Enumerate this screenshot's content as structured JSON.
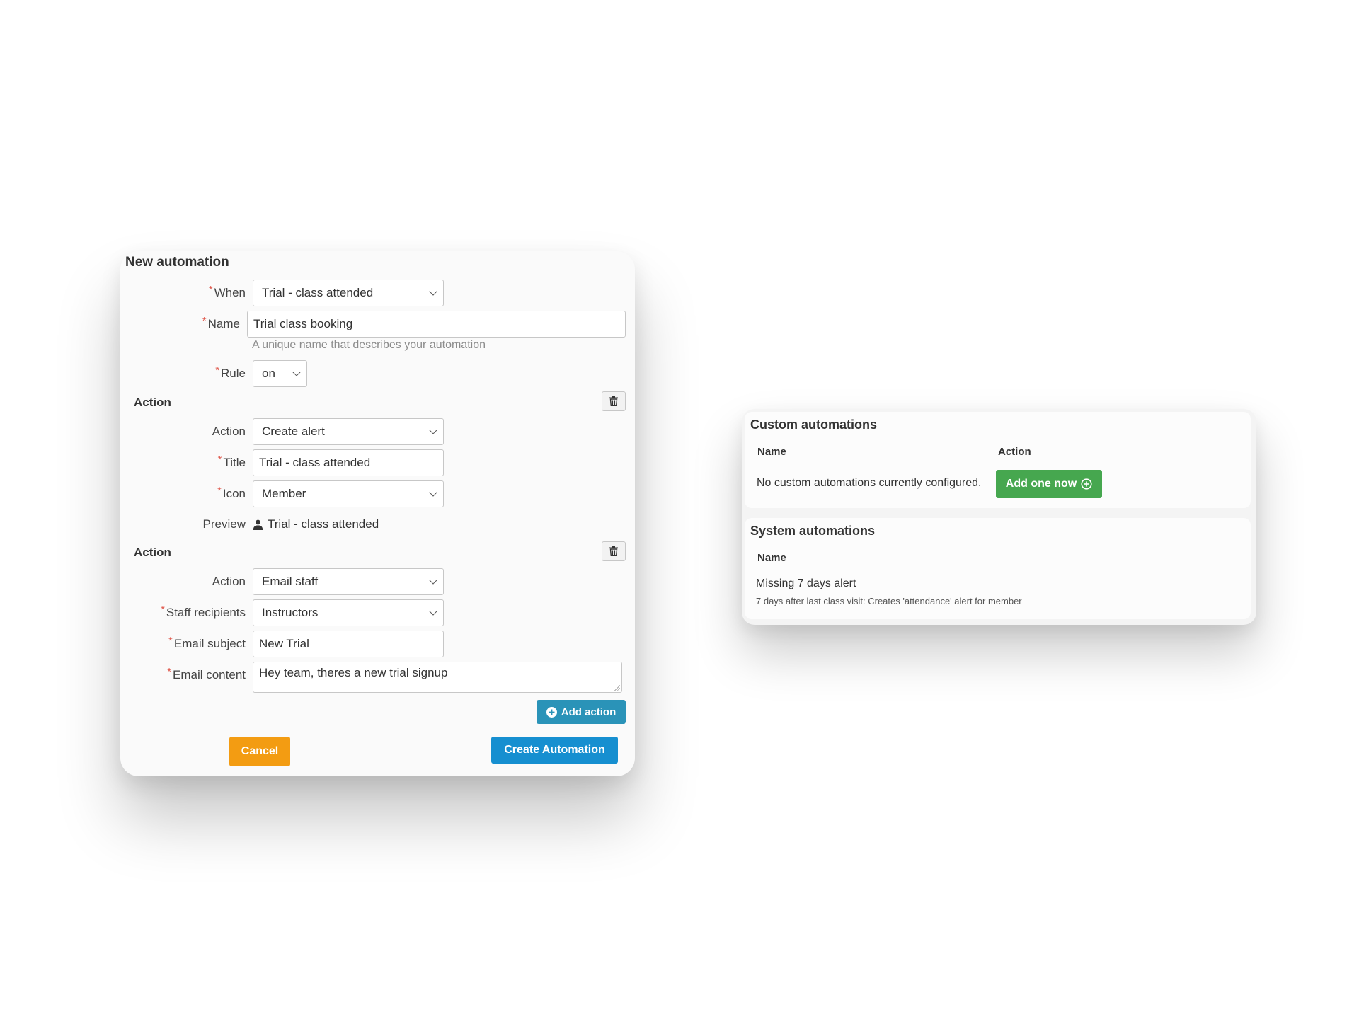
{
  "new_automation": {
    "title": "New automation",
    "when": {
      "label": "When",
      "value": "Trial - class attended"
    },
    "name": {
      "label": "Name",
      "value": "Trial class booking",
      "help": "A unique name that describes your automation"
    },
    "rule": {
      "label": "Rule",
      "value": "on"
    },
    "actions": [
      {
        "header": "Action",
        "action": {
          "label": "Action",
          "value": "Create alert"
        },
        "title": {
          "label": "Title",
          "value": "Trial - class attended"
        },
        "icon": {
          "label": "Icon",
          "value": "Member"
        },
        "preview": {
          "label": "Preview",
          "value": "Trial - class attended"
        }
      },
      {
        "header": "Action",
        "action": {
          "label": "Action",
          "value": "Email staff"
        },
        "staff_recipients": {
          "label": "Staff recipients",
          "value": "Instructors"
        },
        "email_subject": {
          "label": "Email subject",
          "value": "New Trial"
        },
        "email_content": {
          "label": "Email content",
          "value": "Hey team, theres a new trial signup"
        }
      }
    ],
    "add_action_label": "Add action",
    "cancel_label": "Cancel",
    "create_label": "Create Automation"
  },
  "custom_automations": {
    "title": "Custom automations",
    "columns": [
      "Name",
      "Action"
    ],
    "empty_text": "No custom automations currently configured.",
    "add_button_label": "Add one now"
  },
  "system_automations": {
    "title": "System automations",
    "columns": [
      "Name"
    ],
    "rows": [
      {
        "name": "Missing 7 days alert",
        "description": "7 days after last class visit: Creates 'attendance' alert for member"
      }
    ]
  },
  "colors": {
    "cancel": "#f39c12",
    "create": "#168fd0",
    "add_action": "#2a93b8",
    "add_now": "#46a74f",
    "required": "#e05a4e"
  }
}
